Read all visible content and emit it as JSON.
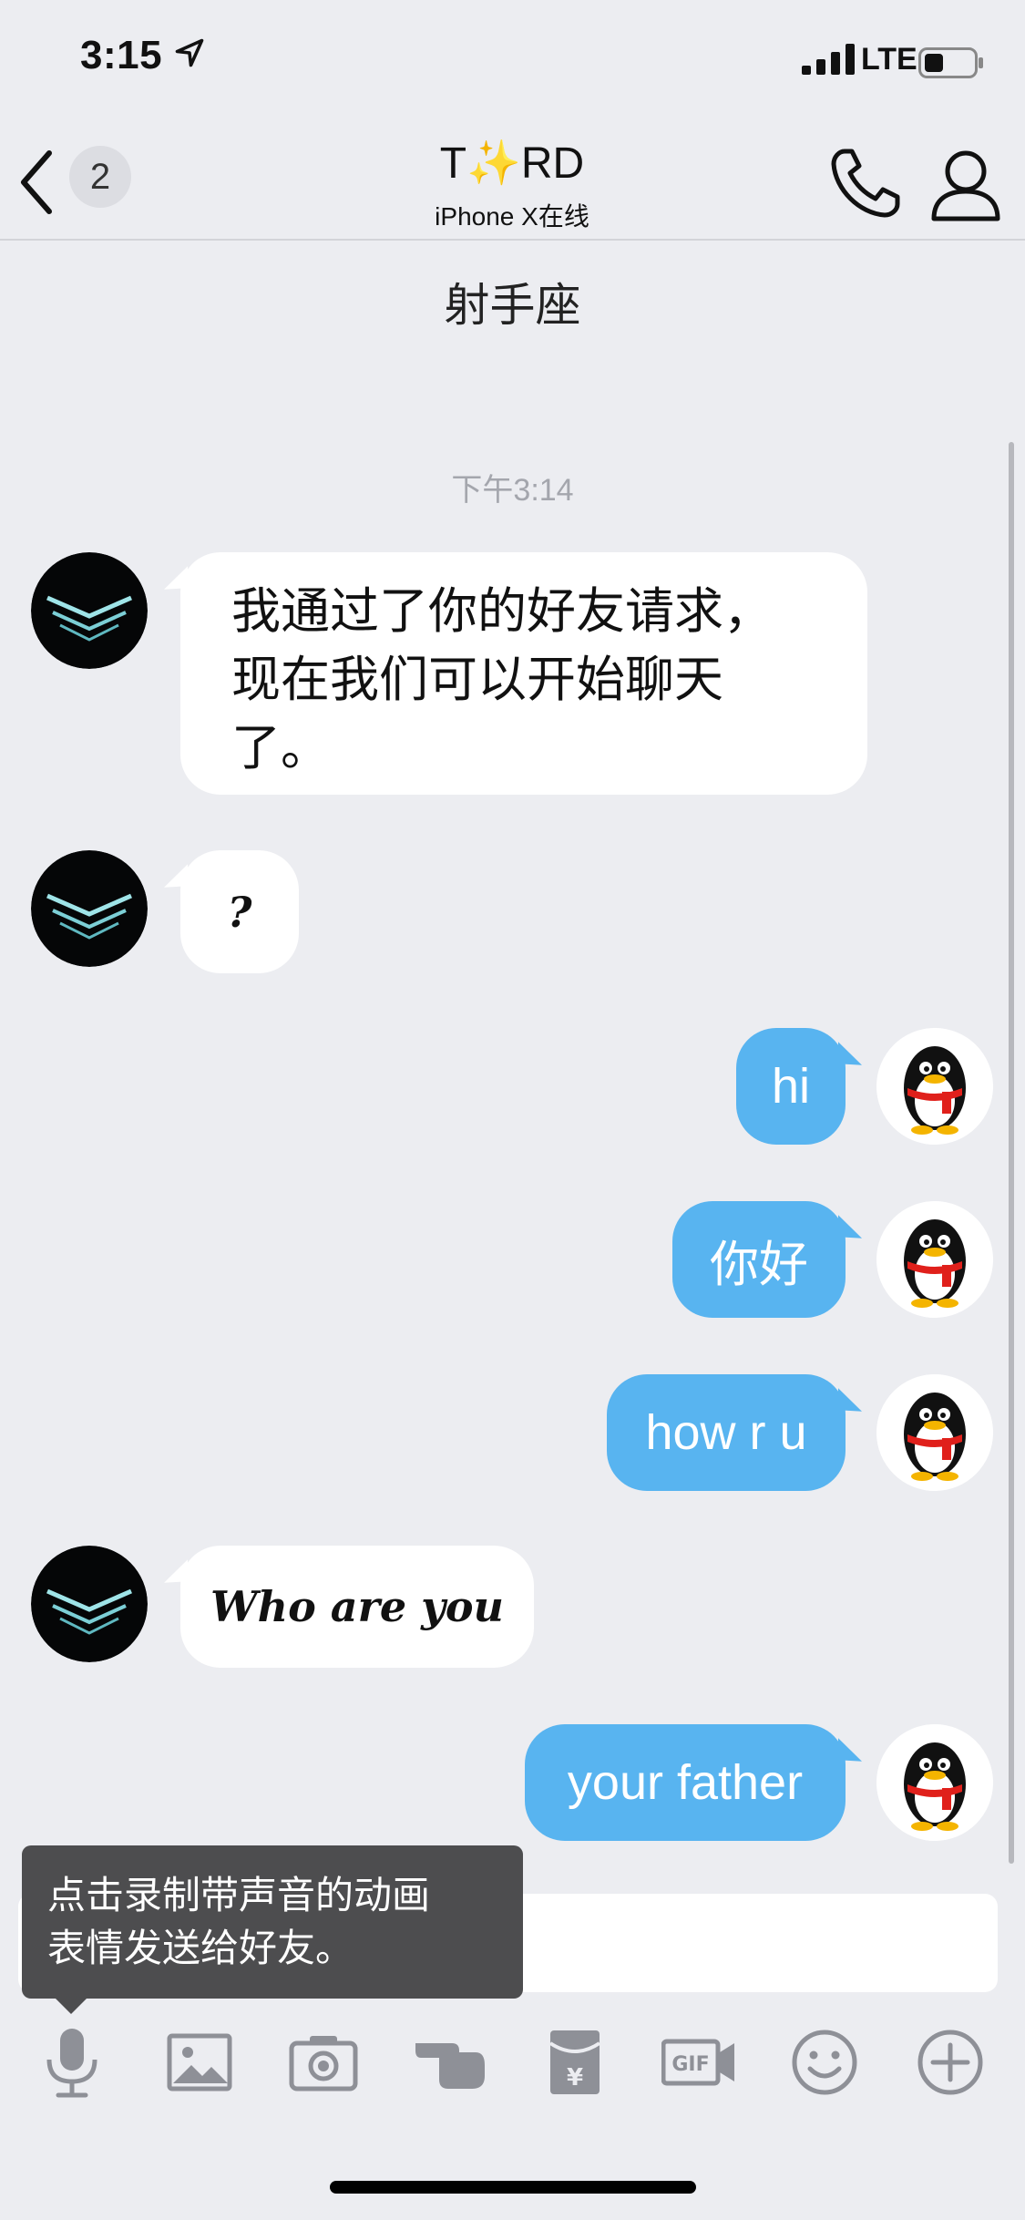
{
  "status_bar": {
    "time": "3:15",
    "network": "LTE"
  },
  "nav": {
    "unread_count": "2",
    "title": "T✨RD",
    "subtitle": "iPhone X在线"
  },
  "group_name": "射手座",
  "timestamp": "下午3:14",
  "messages": [
    {
      "side": "left",
      "line1": "我通过了你的好友请求，",
      "line2": "现在我们可以开始聊天",
      "line3": "了。"
    },
    {
      "side": "left",
      "text": "?"
    },
    {
      "side": "right",
      "text": "hi"
    },
    {
      "side": "right",
      "text": "你好"
    },
    {
      "side": "right",
      "text": "how r u"
    },
    {
      "side": "left",
      "text": "Who are you"
    },
    {
      "side": "right",
      "text": "your father"
    }
  ],
  "tooltip": {
    "line1": "点击录制带声音的动画",
    "line2": "表情发送给好友。"
  },
  "toolbar": [
    "mic-icon",
    "image-icon",
    "camera-icon",
    "poke-hand-icon",
    "red-packet-icon",
    "gif-icon",
    "emoji-icon",
    "plus-icon"
  ],
  "colors": {
    "outgoing_bubble": "#58b4f0",
    "background": "#ecedf1",
    "icon_gray": "#8e9097"
  }
}
